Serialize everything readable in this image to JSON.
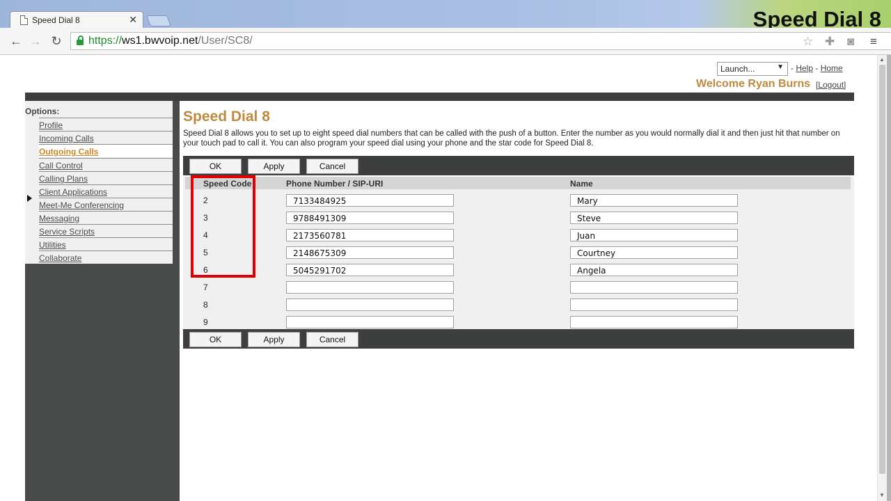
{
  "browser": {
    "tab_title": "Speed Dial 8",
    "tab_close": "✕",
    "url_scheme": "https://",
    "url_host": "ws1.bwvoip.net",
    "url_path": "/User/SC8/"
  },
  "overlay": {
    "title": "Speed Dial 8"
  },
  "header": {
    "launch_select": "Launch...",
    "help": "Help",
    "home": "Home",
    "welcome": "Welcome Ryan Burns",
    "logout": "[Logout]"
  },
  "sidebar": {
    "options_label": "Options:",
    "items": [
      {
        "label": "Profile"
      },
      {
        "label": "Incoming Calls"
      },
      {
        "label": "Outgoing Calls"
      },
      {
        "label": "Call Control"
      },
      {
        "label": "Calling Plans"
      },
      {
        "label": "Client Applications"
      },
      {
        "label": "Meet-Me Conferencing"
      },
      {
        "label": "Messaging"
      },
      {
        "label": "Service Scripts"
      },
      {
        "label": "Utilities"
      },
      {
        "label": "Collaborate"
      }
    ],
    "active_item": "Outgoing Calls"
  },
  "main": {
    "title": "Speed Dial 8",
    "description": "Speed Dial 8 allows you to set up to eight speed dial numbers that can be called with the push of a button. Enter the number as you would normally dial it and then just hit that number on your touch pad to call it. You can also program your speed dial using your phone and the star code for Speed Dial 8.",
    "buttons": {
      "ok": "OK",
      "apply": "Apply",
      "cancel": "Cancel"
    },
    "table": {
      "headers": {
        "code": "Speed Code",
        "phone": "Phone Number / SIP-URI",
        "name": "Name"
      },
      "rows": [
        {
          "code": "2",
          "phone": "7133484925",
          "name": "Mary"
        },
        {
          "code": "3",
          "phone": "9788491309",
          "name": "Steve"
        },
        {
          "code": "4",
          "phone": "2173560781",
          "name": "Juan"
        },
        {
          "code": "5",
          "phone": "2148675309",
          "name": "Courtney"
        },
        {
          "code": "6",
          "phone": "5045291702",
          "name": "Angela"
        },
        {
          "code": "7",
          "phone": "",
          "name": ""
        },
        {
          "code": "8",
          "phone": "",
          "name": ""
        },
        {
          "code": "9",
          "phone": "",
          "name": ""
        }
      ]
    }
  },
  "colors": {
    "accent": "#bf8a3f",
    "dark_band": "#3d3f3e",
    "highlight": "#e00000"
  }
}
